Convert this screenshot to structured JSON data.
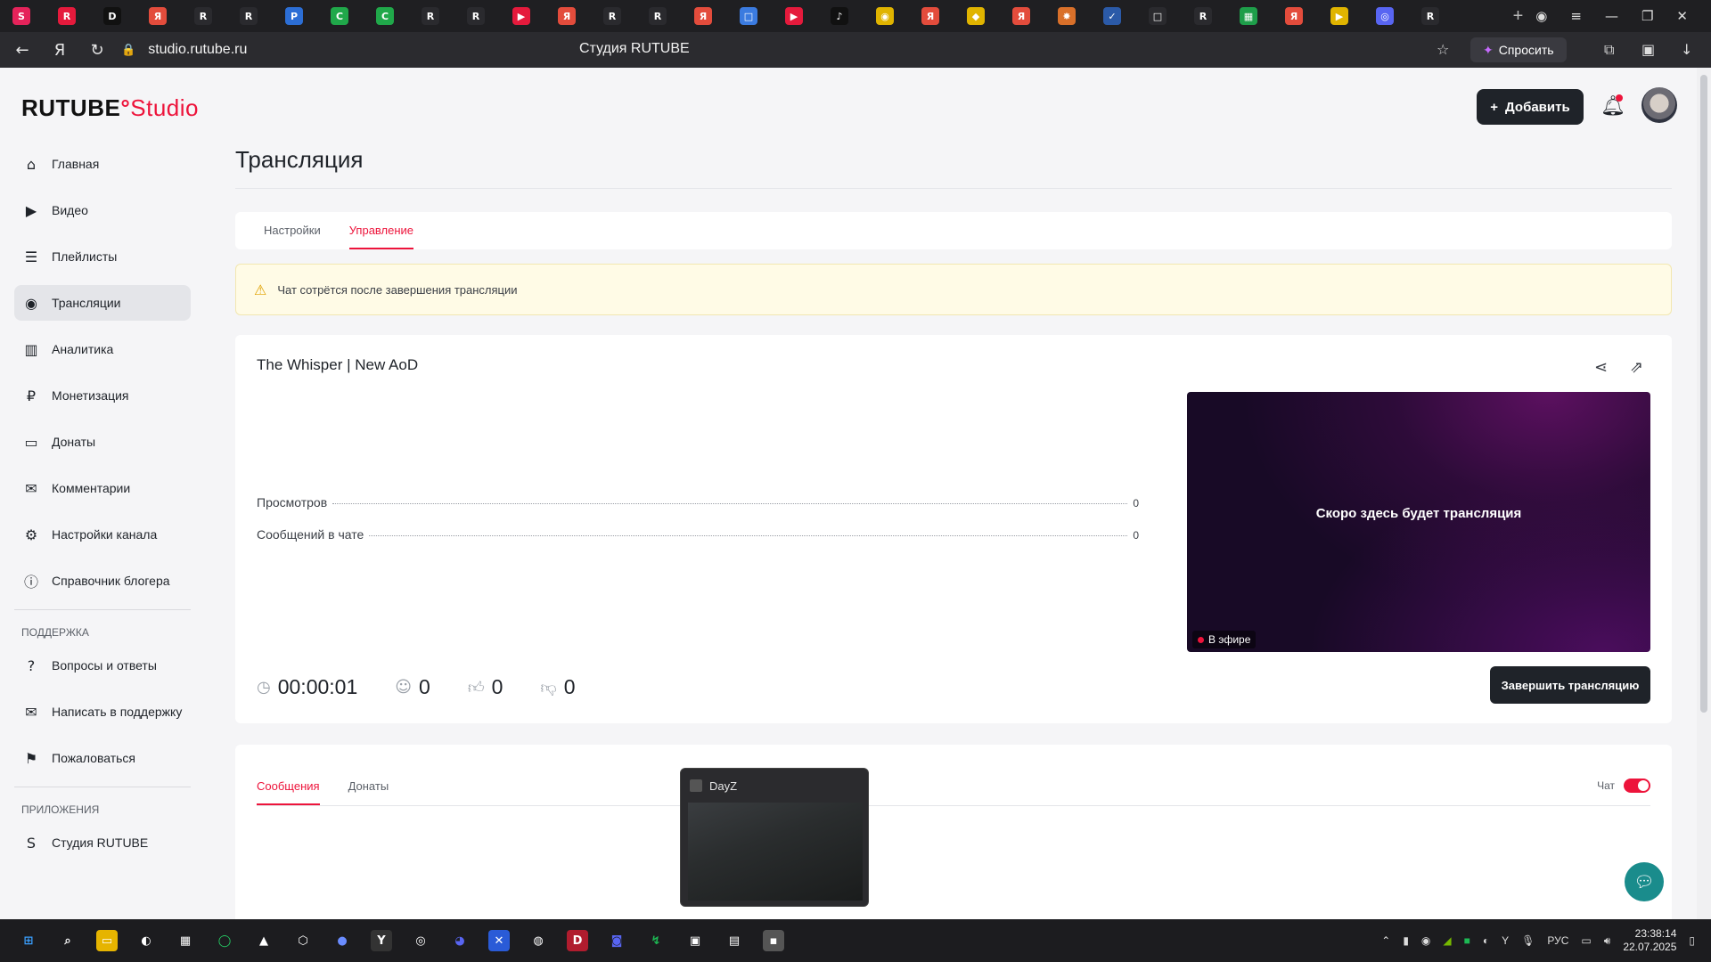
{
  "browser": {
    "url": "studio.rutube.ru",
    "page_title": "Студия RUTUBE",
    "ask_button": "Спросить",
    "tab_icons": [
      {
        "letter": "S",
        "color": "#e5235a"
      },
      {
        "letter": "R",
        "color": "#e51a3c"
      },
      {
        "letter": "D",
        "color": "#111111"
      },
      {
        "letter": "Я",
        "color": "#e34c3c"
      },
      {
        "letter": "R",
        "color": "#2a2a2e"
      },
      {
        "letter": "R",
        "color": "#2a2a2e"
      },
      {
        "letter": "P",
        "color": "#2c6ed5"
      },
      {
        "letter": "C",
        "color": "#20a84a"
      },
      {
        "letter": "C",
        "color": "#20a84a"
      },
      {
        "letter": "R",
        "color": "#2a2a2e"
      },
      {
        "letter": "R",
        "color": "#2a2a2e"
      },
      {
        "letter": "▶",
        "color": "#e51a3c"
      },
      {
        "letter": "Я",
        "color": "#e34c3c"
      },
      {
        "letter": "R",
        "color": "#2a2a2e"
      },
      {
        "letter": "R",
        "color": "#2a2a2e"
      },
      {
        "letter": "Я",
        "color": "#e34c3c"
      },
      {
        "letter": "□",
        "color": "#3b7be0"
      },
      {
        "letter": "▶",
        "color": "#e51a3c"
      },
      {
        "letter": "♪",
        "color": "#111111"
      },
      {
        "letter": "◉",
        "color": "#e0b400"
      },
      {
        "letter": "Я",
        "color": "#e34c3c"
      },
      {
        "letter": "◆",
        "color": "#e0b400"
      },
      {
        "letter": "Я",
        "color": "#e34c3c"
      },
      {
        "letter": "✸",
        "color": "#d9702a"
      },
      {
        "letter": "✓",
        "color": "#2b5aa8"
      },
      {
        "letter": "□",
        "color": "#2a2a2e"
      },
      {
        "letter": "R",
        "color": "#2a2a2e"
      },
      {
        "letter": "▦",
        "color": "#1e9e4a"
      },
      {
        "letter": "Я",
        "color": "#e34c3c"
      },
      {
        "letter": "▶",
        "color": "#e0b400"
      },
      {
        "letter": "◎",
        "color": "#5865f2"
      },
      {
        "letter": "R",
        "color": "#2a2a2e"
      }
    ]
  },
  "header": {
    "logo_main": "RUTUBE",
    "logo_dot": "°",
    "logo_studio": "Studio",
    "add_button": "Добавить"
  },
  "sidebar": {
    "items": [
      {
        "label": "Главная",
        "icon": "home-icon",
        "glyph": "⌂"
      },
      {
        "label": "Видео",
        "icon": "video-icon",
        "glyph": "▶"
      },
      {
        "label": "Плейлисты",
        "icon": "playlist-icon",
        "glyph": "☰"
      },
      {
        "label": "Трансляции",
        "icon": "broadcast-icon",
        "glyph": "◉"
      },
      {
        "label": "Аналитика",
        "icon": "analytics-icon",
        "glyph": "▥"
      },
      {
        "label": "Монетизация",
        "icon": "ruble-icon",
        "glyph": "₽"
      },
      {
        "label": "Донаты",
        "icon": "wallet-icon",
        "glyph": "▭"
      },
      {
        "label": "Комментарии",
        "icon": "comment-icon",
        "glyph": "✉"
      },
      {
        "label": "Настройки канала",
        "icon": "gear-icon",
        "glyph": "⚙"
      },
      {
        "label": "Справочник блогера",
        "icon": "info-icon",
        "glyph": "ⓘ"
      }
    ],
    "support_heading": "ПОДДЕРЖКА",
    "support_items": [
      {
        "label": "Вопросы и ответы",
        "icon": "question-icon",
        "glyph": "?"
      },
      {
        "label": "Написать в поддержку",
        "icon": "mail-icon",
        "glyph": "✉"
      },
      {
        "label": "Пожаловаться",
        "icon": "flag-icon",
        "glyph": "⚑"
      }
    ],
    "apps_heading": "ПРИЛОЖЕНИЯ",
    "apps_items": [
      {
        "label": "Студия RUTUBE",
        "icon": "studio-app-icon",
        "glyph": "S"
      }
    ]
  },
  "main": {
    "title": "Трансляция",
    "tabs": [
      "Настройки",
      "Управление"
    ],
    "warning": "Чат сотрётся после завершения трансляции",
    "stream": {
      "title": "The Whisper | New AoD",
      "stats": [
        {
          "label": "Просмотров",
          "value": "0"
        },
        {
          "label": "Сообщений в чате",
          "value": "0"
        }
      ],
      "preview_text": "Скоро здесь будет трансляция",
      "live_badge": "В эфире",
      "duration": "00:00:01",
      "viewers": "0",
      "likes": "0",
      "dislikes": "0",
      "end_button": "Завершить трансляцию"
    },
    "messages": {
      "tabs": [
        "Сообщения",
        "Донаты"
      ],
      "chat_label": "Чат"
    }
  },
  "taskbar": {
    "preview_title": "DayZ",
    "tray_lang": "РУС",
    "time": "23:38:14",
    "date": "22.07.2025"
  }
}
